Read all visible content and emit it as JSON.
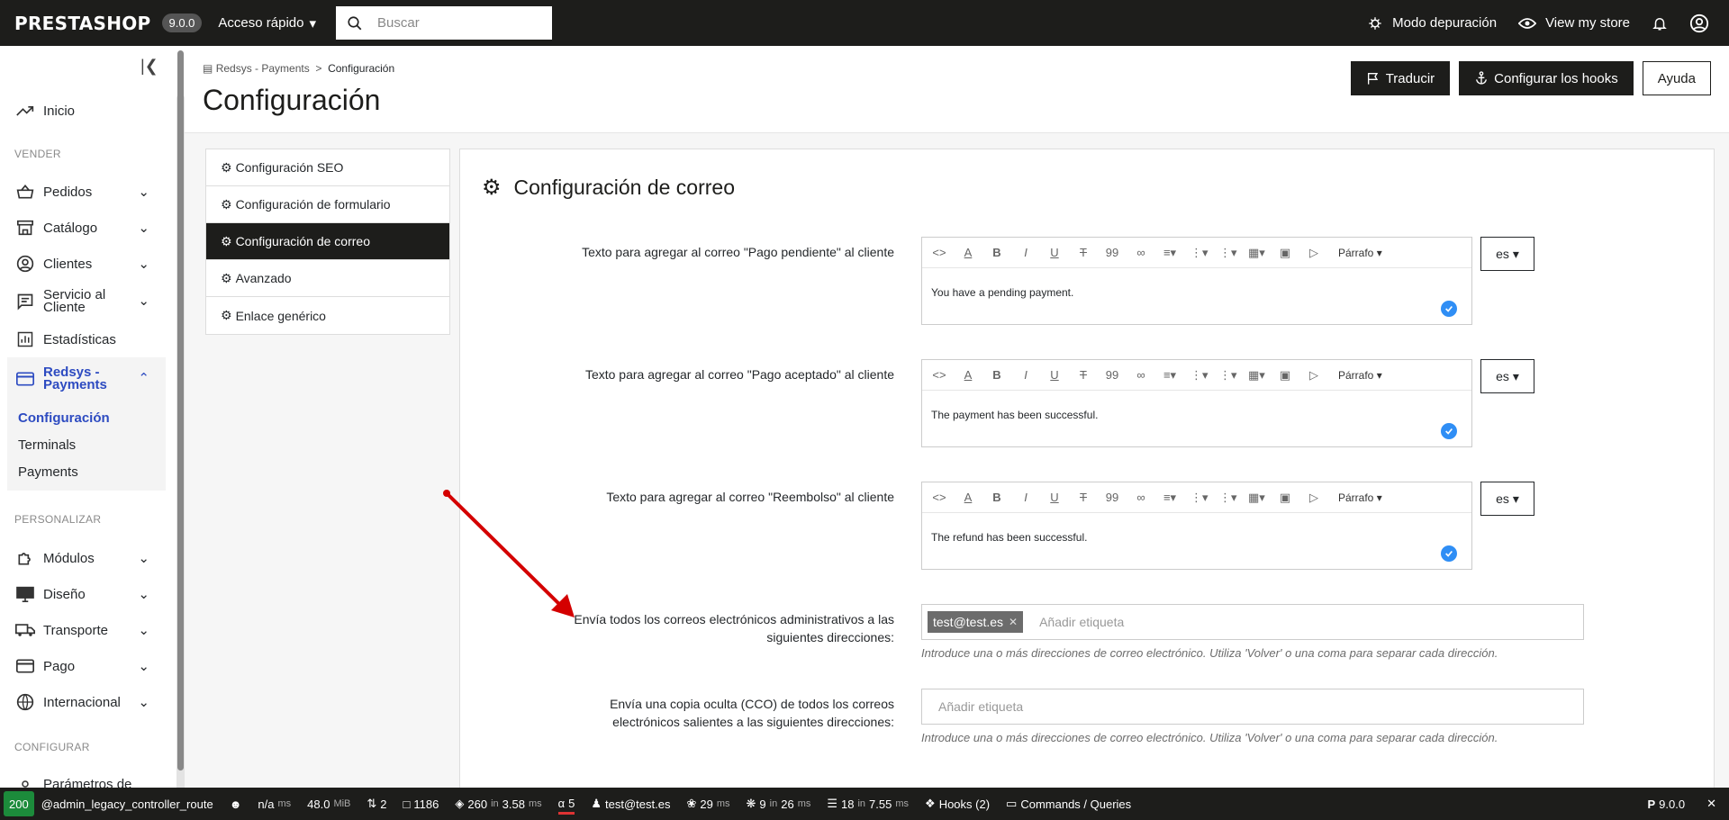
{
  "topbar": {
    "logo": "PRESTASHOP",
    "version": "9.0.0",
    "quick_access": "Acceso rápido",
    "search_placeholder": "Buscar",
    "debug_mode": "Modo depuración",
    "view_store": "View my store"
  },
  "sidebar": {
    "home": "Inicio",
    "section_sell": "VENDER",
    "orders": "Pedidos",
    "catalog": "Catálogo",
    "customers": "Clientes",
    "customer_service": "Servicio al Cliente",
    "stats": "Estadísticas",
    "redsys": "Redsys - Payments",
    "sub_config": "Configuración",
    "sub_terminals": "Terminals",
    "sub_payments": "Payments",
    "section_customize": "PERSONALIZAR",
    "modules": "Módulos",
    "design": "Diseño",
    "shipping": "Transporte",
    "payment": "Pago",
    "international": "Internacional",
    "section_configure": "CONFIGURAR",
    "shop_params": "Parámetros de"
  },
  "header": {
    "breadcrumb_parent": "Redsys - Payments",
    "breadcrumb_sep": ">",
    "breadcrumb_current": "Configuración",
    "title": "Configuración",
    "btn_translate": "Traducir",
    "btn_hooks": "Configurar los hooks",
    "btn_help": "Ayuda"
  },
  "tabs": [
    {
      "label": "Configuración SEO"
    },
    {
      "label": "Configuración de formulario"
    },
    {
      "label": "Configuración de correo"
    },
    {
      "label": "Avanzado"
    },
    {
      "label": "Enlace genérico"
    }
  ],
  "panel": {
    "title": "Configuración de correo",
    "paragraph_label": "Párrafo",
    "lang": "es",
    "field1_label": "Texto para agregar al correo \"Pago pendiente\" al cliente",
    "field1_value": "You have a pending payment.",
    "field2_label": "Texto para agregar al correo \"Pago aceptado\" al cliente",
    "field2_value": "The payment has been successful.",
    "field3_label": "Texto para agregar al correo \"Reembolso\" al cliente",
    "field3_value": "The refund has been successful.",
    "field4_label": "Envía todos los correos electrónicos administrativos a las siguientes direcciones:",
    "field4_tag": "test@test.es",
    "tag_placeholder": "Añadir etiqueta",
    "field4_help": "Introduce una o más direcciones de correo electrónico. Utiliza 'Volver' o una coma para separar cada dirección.",
    "field5_label": "Envía una copia oculta (CCO) de todos los correos electrónicos salientes a las siguientes direcciones:",
    "field5_help": "Introduce una o más direcciones de correo electrónico. Utiliza 'Volver' o una coma para separar cada dirección."
  },
  "debugbar": {
    "status": "200",
    "route": "@admin_legacy_controller_route",
    "time": "n/a",
    "time_unit": "ms",
    "memory": "48.0",
    "memory_unit": "MiB",
    "requests": "2",
    "files": "1186",
    "twig": "260",
    "twig_in": "in",
    "twig_time": "3.58",
    "twig_unit": "ms",
    "translations": "5",
    "user": "test@test.es",
    "events_time": "29",
    "events_unit": "ms",
    "listeners": "9",
    "listeners_in": "in",
    "listeners_time": "26",
    "listeners_unit": "ms",
    "db": "18",
    "db_in": "in",
    "db_time": "7.55",
    "db_unit": "ms",
    "hooks": "Hooks (2)",
    "commands": "Commands / Queries",
    "php_version": "9.0.0"
  }
}
